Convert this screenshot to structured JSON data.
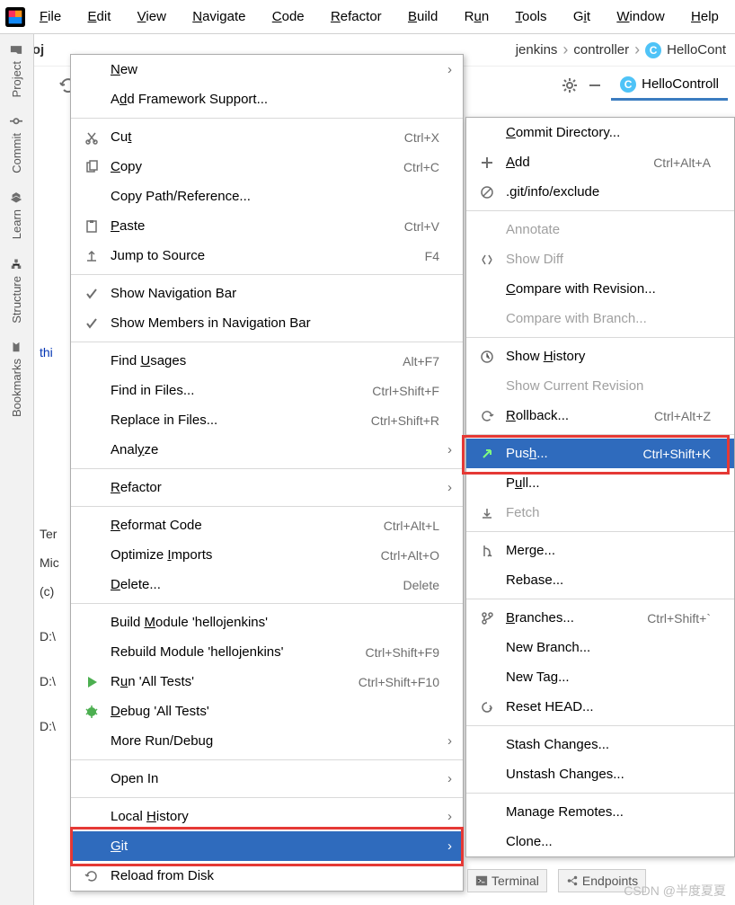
{
  "menubar": [
    "File",
    "Edit",
    "View",
    "Navigate",
    "Code",
    "Refactor",
    "Build",
    "Run",
    "Tools",
    "Git",
    "Window",
    "Help"
  ],
  "menubar_mnemonic": [
    0,
    0,
    0,
    0,
    0,
    0,
    0,
    1,
    0,
    1,
    0,
    0
  ],
  "breadcrumb": {
    "project": "helloj",
    "pkg": "jenkins",
    "sub": "controller",
    "cls": "HelloCont"
  },
  "tab_open": "HelloControll",
  "left_tabs": [
    "Project",
    "Commit",
    "Learn",
    "Structure",
    "Bookmarks"
  ],
  "bg": {
    "ter": "Ter",
    "mic": "Mic",
    "c": "(c)",
    "dv": "D:\\",
    "thi": "thi"
  },
  "ctx1": [
    {
      "t": "item",
      "label": "New",
      "arrow": true,
      "mn": 0
    },
    {
      "t": "item",
      "label": "Add Framework Support...",
      "mn": 1
    },
    {
      "t": "sep"
    },
    {
      "t": "item",
      "label": "Cut",
      "sc": "Ctrl+X",
      "icon": "cut",
      "mn": 2
    },
    {
      "t": "item",
      "label": "Copy",
      "sc": "Ctrl+C",
      "icon": "copy",
      "mn": 0
    },
    {
      "t": "item",
      "label": "Copy Path/Reference..."
    },
    {
      "t": "item",
      "label": "Paste",
      "sc": "Ctrl+V",
      "icon": "paste",
      "mn": 0
    },
    {
      "t": "item",
      "label": "Jump to Source",
      "sc": "F4",
      "icon": "jump"
    },
    {
      "t": "sep"
    },
    {
      "t": "item",
      "label": "Show Navigation Bar",
      "icon": "check"
    },
    {
      "t": "item",
      "label": "Show Members in Navigation Bar",
      "icon": "check"
    },
    {
      "t": "sep"
    },
    {
      "t": "item",
      "label": "Find Usages",
      "sc": "Alt+F7",
      "mn": 5
    },
    {
      "t": "item",
      "label": "Find in Files...",
      "sc": "Ctrl+Shift+F"
    },
    {
      "t": "item",
      "label": "Replace in Files...",
      "sc": "Ctrl+Shift+R"
    },
    {
      "t": "item",
      "label": "Analyze",
      "arrow": true,
      "mn": 4
    },
    {
      "t": "sep"
    },
    {
      "t": "item",
      "label": "Refactor",
      "arrow": true,
      "mn": 0
    },
    {
      "t": "sep"
    },
    {
      "t": "item",
      "label": "Reformat Code",
      "sc": "Ctrl+Alt+L",
      "mn": 0
    },
    {
      "t": "item",
      "label": "Optimize Imports",
      "sc": "Ctrl+Alt+O",
      "mn": 9
    },
    {
      "t": "item",
      "label": "Delete...",
      "sc": "Delete",
      "mn": 0
    },
    {
      "t": "sep"
    },
    {
      "t": "item",
      "label": "Build Module 'hellojenkins'",
      "mn": 6
    },
    {
      "t": "item",
      "label": "Rebuild Module 'hellojenkins'",
      "sc": "Ctrl+Shift+F9"
    },
    {
      "t": "item",
      "label": "Run 'All Tests'",
      "sc": "Ctrl+Shift+F10",
      "icon": "run",
      "mn": 1
    },
    {
      "t": "item",
      "label": "Debug 'All Tests'",
      "icon": "debug",
      "mn": 0
    },
    {
      "t": "item",
      "label": "More Run/Debug",
      "arrow": true
    },
    {
      "t": "sep"
    },
    {
      "t": "item",
      "label": "Open In",
      "arrow": true
    },
    {
      "t": "sep"
    },
    {
      "t": "item",
      "label": "Local History",
      "arrow": true,
      "mn": 6
    },
    {
      "t": "item",
      "label": "Git",
      "arrow": true,
      "sel": true,
      "mn": 0
    },
    {
      "t": "item",
      "label": "Reload from Disk",
      "icon": "reload"
    }
  ],
  "ctx2": [
    {
      "t": "item",
      "label": "Commit Directory...",
      "mn": 0
    },
    {
      "t": "item",
      "label": "Add",
      "sc": "Ctrl+Alt+A",
      "icon": "plus",
      "mn": 0
    },
    {
      "t": "item",
      "label": ".git/info/exclude",
      "icon": "exclude"
    },
    {
      "t": "sep"
    },
    {
      "t": "item",
      "label": "Annotate",
      "disabled": true
    },
    {
      "t": "item",
      "label": "Show Diff",
      "disabled": true,
      "icon": "diff"
    },
    {
      "t": "item",
      "label": "Compare with Revision...",
      "mn": 0
    },
    {
      "t": "item",
      "label": "Compare with Branch...",
      "disabled": true
    },
    {
      "t": "sep"
    },
    {
      "t": "item",
      "label": "Show History",
      "icon": "clock",
      "mn": 5
    },
    {
      "t": "item",
      "label": "Show Current Revision",
      "disabled": true
    },
    {
      "t": "item",
      "label": "Rollback...",
      "sc": "Ctrl+Alt+Z",
      "icon": "rollback",
      "mn": 0
    },
    {
      "t": "sep"
    },
    {
      "t": "item",
      "label": "Push...",
      "sc": "Ctrl+Shift+K",
      "icon": "push",
      "sel": true,
      "mn": 3
    },
    {
      "t": "item",
      "label": "Pull...",
      "mn": 1
    },
    {
      "t": "item",
      "label": "Fetch",
      "disabled": true,
      "icon": "fetch"
    },
    {
      "t": "sep"
    },
    {
      "t": "item",
      "label": "Merge...",
      "icon": "merge"
    },
    {
      "t": "item",
      "label": "Rebase..."
    },
    {
      "t": "sep"
    },
    {
      "t": "item",
      "label": "Branches...",
      "sc": "Ctrl+Shift+`",
      "icon": "branch",
      "mn": 0
    },
    {
      "t": "item",
      "label": "New Branch..."
    },
    {
      "t": "item",
      "label": "New Tag..."
    },
    {
      "t": "item",
      "label": "Reset HEAD...",
      "icon": "reset"
    },
    {
      "t": "sep"
    },
    {
      "t": "item",
      "label": "Stash Changes..."
    },
    {
      "t": "item",
      "label": "Unstash Changes..."
    },
    {
      "t": "sep"
    },
    {
      "t": "item",
      "label": "Manage Remotes..."
    },
    {
      "t": "item",
      "label": "Clone..."
    }
  ],
  "bottom_tabs": {
    "terminal": "Terminal",
    "endpoints": "Endpoints"
  },
  "watermark": "CSDN @半度夏夏"
}
